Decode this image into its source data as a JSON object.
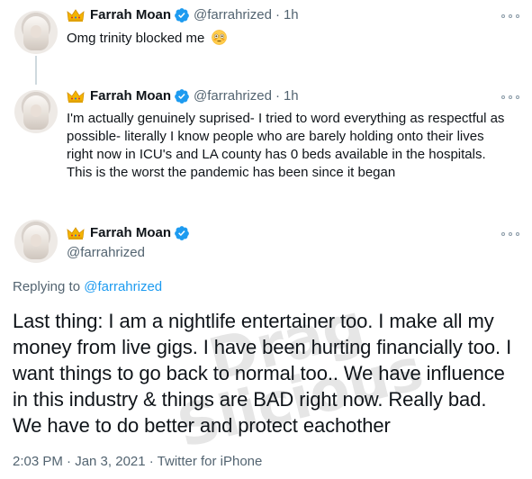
{
  "tweets": [
    {
      "name": "Farrah Moan",
      "handle": "@farrahrized",
      "separator": "·",
      "time": "1h",
      "text": "Omg trinity blocked me",
      "emoji": "flushed-face-emoji"
    },
    {
      "name": "Farrah Moan",
      "handle": "@farrahrized",
      "separator": "·",
      "time": "1h",
      "lines": [
        "I'm actually genuinely suprised- I tried to word everything as respectful as",
        "possible- literally I know people who are barely holding onto their lives",
        "right now in ICU's and LA county has 0 beds available in the hospitals.",
        "This is the worst the pandemic has been since it began"
      ]
    }
  ],
  "main_tweet": {
    "name": "Farrah Moan",
    "handle": "@farrahrized",
    "replying_prefix": "Replying to",
    "replying_to": "@farrahrized",
    "lines": [
      "Last thing: I am a nightlife entertainer too. I make all my",
      "money from live gigs. I have been hurting financially too. I",
      "want things to go back to normal too.. We have influence",
      "in this industry & things are BAD right now. Really bad.",
      "We have to do better and protect eachother"
    ],
    "timestamp": "2:03 PM · Jan 3, 2021 · Twitter for iPhone"
  },
  "watermark": {
    "text_line1": "Drag",
    "text_line2": "Slicious"
  },
  "colors": {
    "verified": "#1d9bf0",
    "secondary_text": "#536471",
    "link": "#1d9bf0",
    "thread_line": "#cfd9de"
  }
}
